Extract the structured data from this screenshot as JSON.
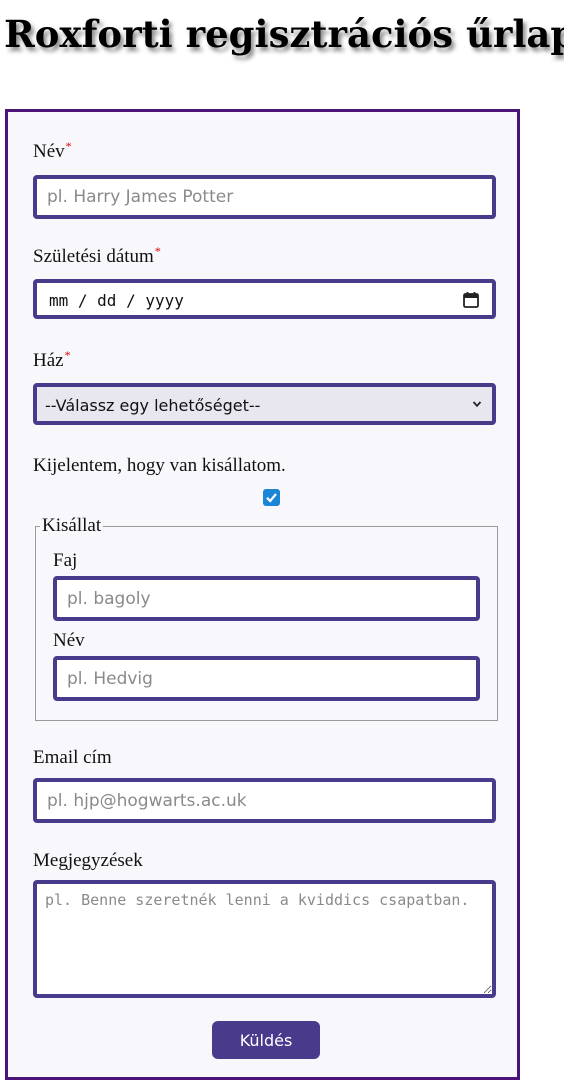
{
  "header": {
    "title": "Roxforti regisztrációs űrlap"
  },
  "form": {
    "name": {
      "label": "Név",
      "required_mark": "*",
      "placeholder": "pl. Harry James Potter"
    },
    "birthdate": {
      "label": "Születési dátum",
      "required_mark": "*",
      "value": "mm / dd / yyyy",
      "icon": "calendar-icon"
    },
    "house": {
      "label": "Ház",
      "required_mark": "*",
      "selected": "--Válassz egy lehetőséget--",
      "icon": "chevron-down-icon"
    },
    "pet_declaration": {
      "label": "Kijelentem, hogy van kisállatom.",
      "checked": true
    },
    "pet": {
      "legend": "Kisállat",
      "species": {
        "label": "Faj",
        "placeholder": "pl. bagoly"
      },
      "name": {
        "label": "Név",
        "placeholder": "pl. Hedvig"
      }
    },
    "email": {
      "label": "Email cím",
      "placeholder": "pl. hjp@hogwarts.ac.uk"
    },
    "notes": {
      "label": "Megjegyzések",
      "placeholder": "pl. Benne szeretnék lenni a kviddics csapatban."
    },
    "submit_label": "Küldés"
  },
  "colors": {
    "frame": "#4b1577",
    "input_border": "#4a3a8c",
    "button": "#4a3a8c",
    "checkbox": "#1b85d6",
    "required": "#e00000"
  }
}
